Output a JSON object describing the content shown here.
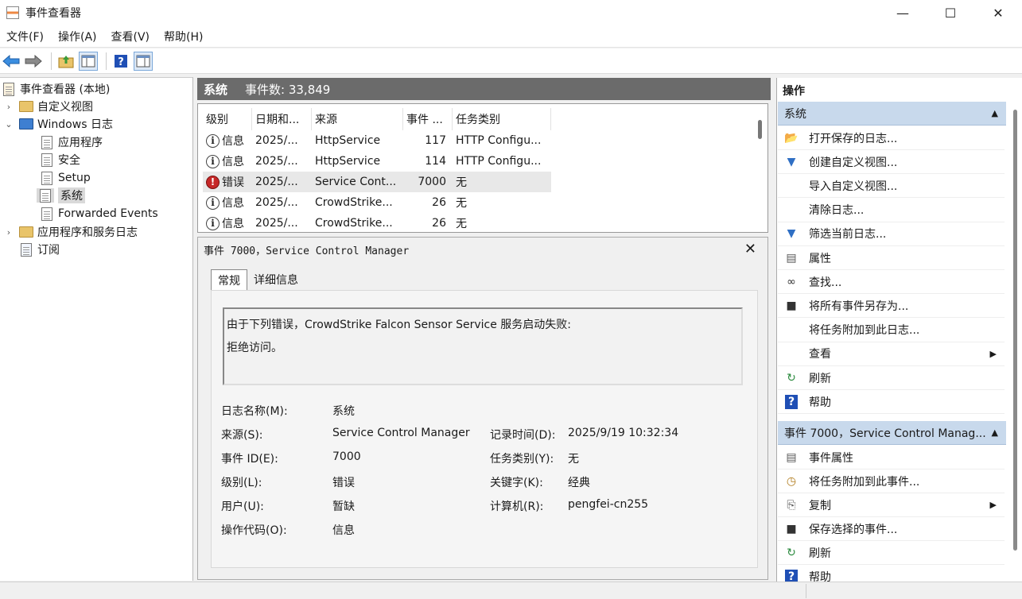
{
  "window": {
    "title": "事件查看器",
    "controls": {
      "minimize": "—",
      "maximize": "☐",
      "close": "✕"
    }
  },
  "menu": [
    "文件(F)",
    "操作(A)",
    "查看(V)",
    "帮助(H)"
  ],
  "tree": {
    "root": "事件查看器 (本地)",
    "custom_views": "自定义视图",
    "windows_logs": "Windows 日志",
    "logs": [
      "应用程序",
      "安全",
      "Setup",
      "系统",
      "Forwarded Events"
    ],
    "selected_log": "系统",
    "app_service_logs": "应用程序和服务日志",
    "subscriptions": "订阅"
  },
  "center": {
    "log_name": "系统",
    "event_count": "事件数: 33,849",
    "columns": [
      "级别",
      "日期和...",
      "来源",
      "事件 ...",
      "任务类别"
    ],
    "rows": [
      {
        "level": "信息",
        "type": "info",
        "date": "2025/...",
        "source": "HttpService",
        "id": "117",
        "task": "HTTP Configu..."
      },
      {
        "level": "信息",
        "type": "info",
        "date": "2025/...",
        "source": "HttpService",
        "id": "114",
        "task": "HTTP Configu..."
      },
      {
        "level": "错误",
        "type": "err",
        "date": "2025/...",
        "source": "Service Cont...",
        "id": "7000",
        "task": "无"
      },
      {
        "level": "信息",
        "type": "info",
        "date": "2025/...",
        "source": "CrowdStrike...",
        "id": "26",
        "task": "无"
      },
      {
        "level": "信息",
        "type": "info",
        "date": "2025/...",
        "source": "CrowdStrike...",
        "id": "26",
        "task": "无"
      }
    ]
  },
  "detail": {
    "title": "事件 7000，Service Control Manager",
    "close": "✕",
    "tabs": [
      "常规",
      "详细信息"
    ],
    "message_line1": "由于下列错误，CrowdStrike Falcon Sensor Service 服务启动失败:",
    "message_line2": "拒绝访问。",
    "fields": {
      "log_name_label": "日志名称(M):",
      "log_name_value": "系统",
      "source_label": "来源(S):",
      "source_value": "Service Control Manager",
      "logged_label": "记录时间(D):",
      "logged_value": "2025/9/19 10:32:34",
      "event_id_label": "事件 ID(E):",
      "event_id_value": "7000",
      "task_label": "任务类别(Y):",
      "task_value": "无",
      "level_label": "级别(L):",
      "level_value": "错误",
      "keywords_label": "关键字(K):",
      "keywords_value": "经典",
      "user_label": "用户(U):",
      "user_value": "暂缺",
      "computer_label": "计算机(R):",
      "computer_value": "pengfei-cn255",
      "opcode_label": "操作代码(O):",
      "opcode_value": "信息"
    }
  },
  "actions": {
    "title": "操作",
    "section1": "系统",
    "items1": [
      {
        "label": "打开保存的日志...",
        "icon": "open-folder-icon",
        "glyph": "📂"
      },
      {
        "label": "创建自定义视图...",
        "icon": "filter-icon",
        "glyph": "▼"
      },
      {
        "label": "导入自定义视图...",
        "icon": "",
        "glyph": ""
      },
      {
        "label": "清除日志...",
        "icon": "",
        "glyph": ""
      },
      {
        "label": "筛选当前日志...",
        "icon": "filter-icon",
        "glyph": "▼"
      },
      {
        "label": "属性",
        "icon": "properties-icon",
        "glyph": "▤"
      },
      {
        "label": "查找...",
        "icon": "binoculars-icon",
        "glyph": "∞"
      },
      {
        "label": "将所有事件另存为...",
        "icon": "save-icon",
        "glyph": "■"
      },
      {
        "label": "将任务附加到此日志...",
        "icon": "",
        "glyph": ""
      },
      {
        "label": "查看",
        "icon": "",
        "glyph": "",
        "submenu": "▶"
      },
      {
        "label": "刷新",
        "icon": "refresh-icon",
        "glyph": "↻"
      },
      {
        "label": "帮助",
        "icon": "help-icon",
        "glyph": "?"
      }
    ],
    "section2": "事件 7000，Service Control Manag...",
    "items2": [
      {
        "label": "事件属性",
        "icon": "properties-icon",
        "glyph": "▤"
      },
      {
        "label": "将任务附加到此事件...",
        "icon": "clock-icon",
        "glyph": "◷"
      },
      {
        "label": "复制",
        "icon": "copy-icon",
        "glyph": "⎘",
        "submenu": "▶"
      },
      {
        "label": "保存选择的事件...",
        "icon": "save-icon",
        "glyph": "■"
      },
      {
        "label": "刷新",
        "icon": "refresh-icon",
        "glyph": "↻"
      },
      {
        "label": "帮助",
        "icon": "help-icon",
        "glyph": "?"
      }
    ],
    "collapse_glyph": "▲"
  }
}
